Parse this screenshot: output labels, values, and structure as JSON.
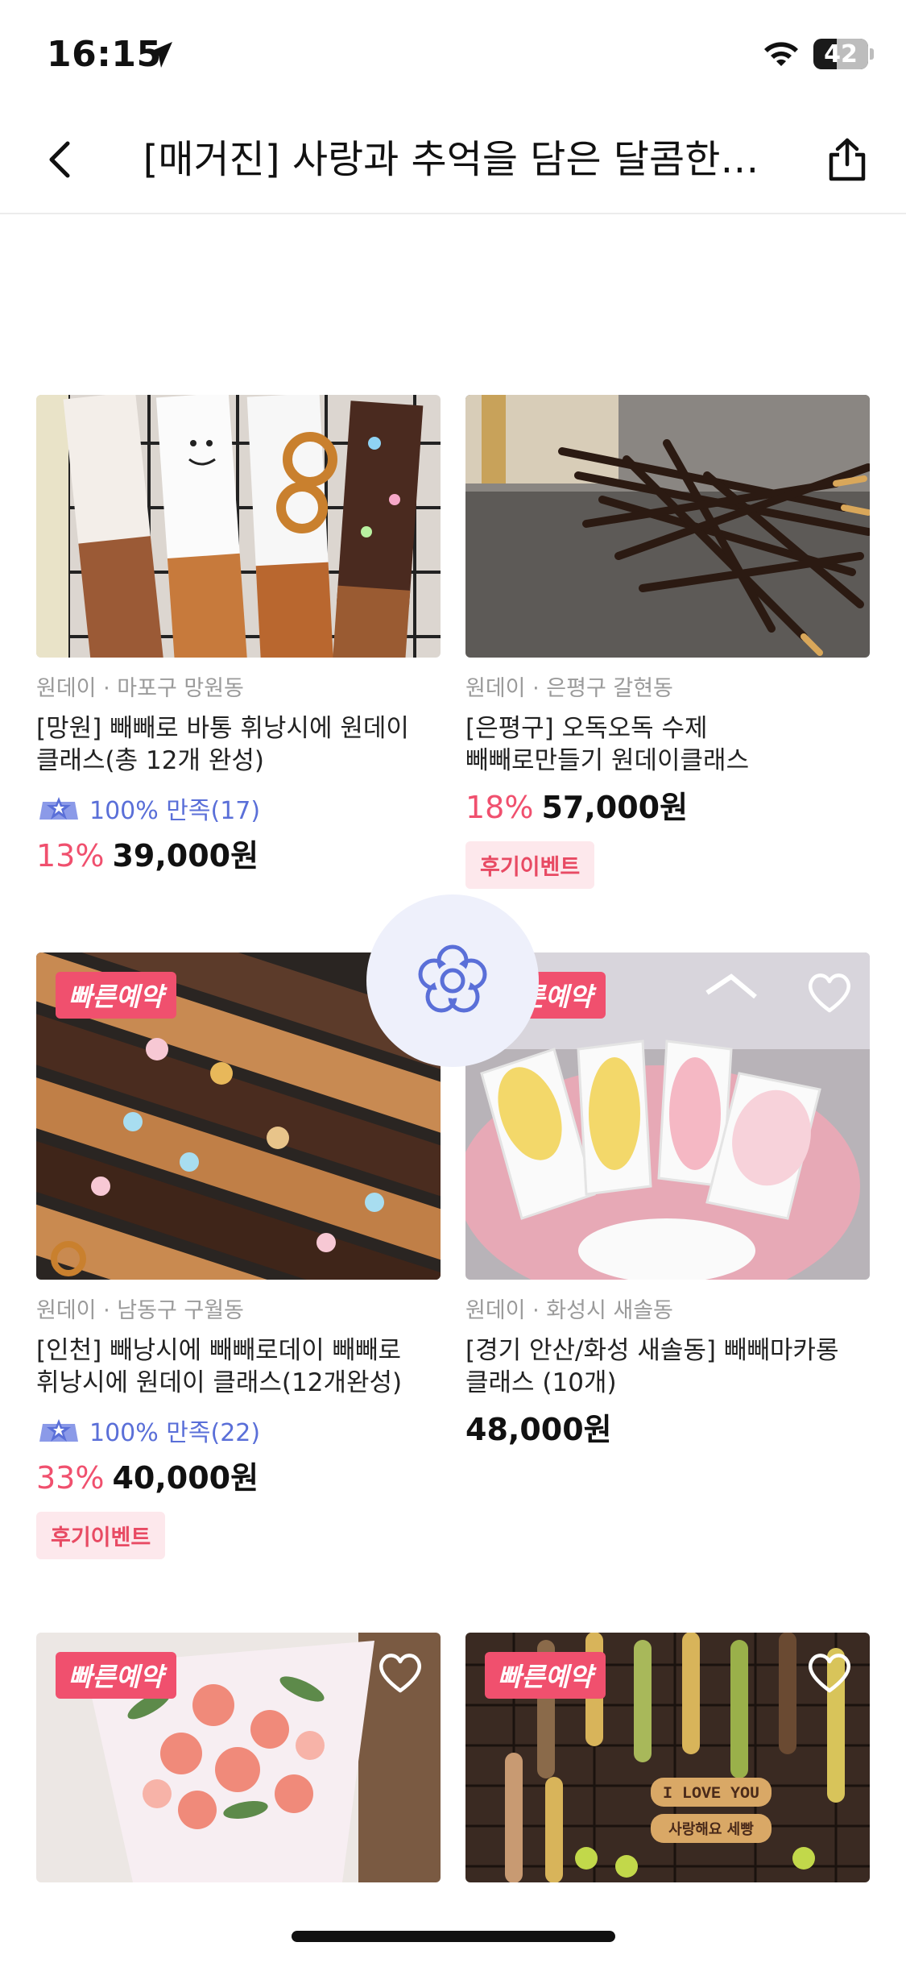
{
  "status": {
    "time": "16:15",
    "battery": "42",
    "battery_fraction": 0.42
  },
  "header": {
    "title": "[매거진] 사랑과 추억을 담은 달콤한…"
  },
  "products": [
    {
      "location": "원데이 · 마포구 망원동",
      "title_line1": "[망원] 빼빼로 바통 휘낭시에 원데이",
      "title_line2": "클래스(총 12개 완성)",
      "rating": "100% 만족(17)",
      "discount": "13%",
      "price": "39,000원"
    },
    {
      "location": "원데이 · 은평구 갈현동",
      "title_line1": "[은평구] 오독오독 수제",
      "title_line2": "빼빼로만들기 원데이클래스",
      "discount": "18%",
      "price": "57,000원",
      "tag": "후기이벤트"
    },
    {
      "badge": "빠른예약",
      "location": "원데이 · 남동구 구월동",
      "title_line1": "[인천] 빼낭시에 빼빼로데이 빼빼로",
      "title_line2": "휘낭시에 원데이 클래스(12개완성)",
      "rating": "100% 만족(22)",
      "discount": "33%",
      "price": "40,000원",
      "tag": "후기이벤트"
    },
    {
      "badge": "빠른예약",
      "location": "원데이 · 화성시 새솔동",
      "title_line1": "[경기 안산/화성 새솔동] 빼빼마카롱",
      "title_line2": "클래스 (10개)",
      "price": "48,000원"
    },
    {
      "badge": "빠른예약"
    },
    {
      "badge": "빠른예약",
      "photo_text_1": "I LOVE YOU",
      "photo_text_2": "사랑해요 세빵"
    }
  ],
  "icons": {
    "back": "chevron-left-icon",
    "share": "share-icon",
    "fab": "flower-icon",
    "heart": "heart-outline-icon",
    "rating": "star-badge-icon"
  },
  "colors": {
    "accent_red": "#f0506e",
    "rating_blue": "#5a6fd8",
    "tag_bg": "#fde8ec"
  }
}
